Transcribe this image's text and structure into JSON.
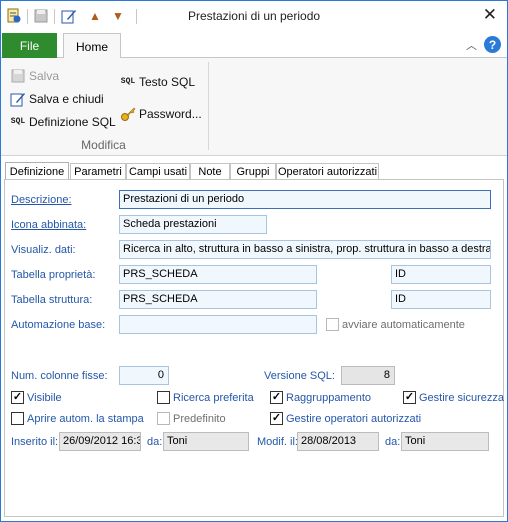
{
  "window": {
    "title": "Prestazioni di un periodo"
  },
  "quick_access": {
    "close_glyph": "✕"
  },
  "ribbon_tabs": {
    "file": "File",
    "home": "Home",
    "help": "?"
  },
  "ribbon": {
    "save": "Salva",
    "save_close": "Salva e chiudi",
    "sql_definition": "Definizione SQL",
    "sql_text": "Testo SQL",
    "password": "Password...",
    "group_label": "Modifica",
    "sql_glyph": "SQL"
  },
  "form_tabs": [
    "Definizione",
    "Parametri",
    "Campi usati",
    "Note",
    "Gruppi",
    "Operatori autorizzati"
  ],
  "form": {
    "descrizione_label": "Descrizione:",
    "descrizione_value": "Prestazioni di un periodo",
    "icona_label": "Icona abbinata:",
    "icona_value": "Scheda prestazioni",
    "visualiz_label": "Visualiz. dati:",
    "visualiz_value": "Ricerca in alto, struttura in basso a sinistra, prop. struttura in basso a destra",
    "tabella_proprieta_label": "Tabella proprietà:",
    "tabella_proprieta_value": "PRS_SCHEDA",
    "tabella_proprieta_id": "ID",
    "tabella_struttura_label": "Tabella struttura:",
    "tabella_struttura_value": "PRS_SCHEDA",
    "tabella_struttura_id": "ID",
    "automazione_label": "Automazione base:",
    "automazione_value": "",
    "avviare_label": "avviare automaticamente",
    "num_colonne_label": "Num. colonne fisse:",
    "num_colonne_value": "0",
    "versione_sql_label": "Versione SQL:",
    "versione_sql_value": "8",
    "visibile_label": "Visibile",
    "ricerca_preferita_label": "Ricerca preferita",
    "raggruppamento_label": "Raggruppamento",
    "gestire_sicurezza_label": "Gestire sicurezza",
    "aprire_autom_label": "Aprire autom. la stampa",
    "predefinito_label": "Predefinito",
    "gestire_operatori_label": "Gestire operatori autorizzati",
    "inserito_label": "Inserito il:",
    "inserito_value": "26/09/2012 16:3",
    "inserito_da_label": "da:",
    "inserito_da_value": "Toni",
    "modif_label": "Modif. il:",
    "modif_value": "28/08/2013",
    "modif_da_label": "da:",
    "modif_da_value": "Toni"
  },
  "checks": {
    "visibile": true,
    "ricerca_preferita": false,
    "raggruppamento": true,
    "gestire_sicurezza": true,
    "aprire_autom": false,
    "predefinito": false,
    "gestire_operatori": true,
    "avviare": false
  },
  "colors": {
    "accent": "#2e8b2e",
    "label": "#2457a8",
    "field_bg": "#f1f8fd"
  }
}
